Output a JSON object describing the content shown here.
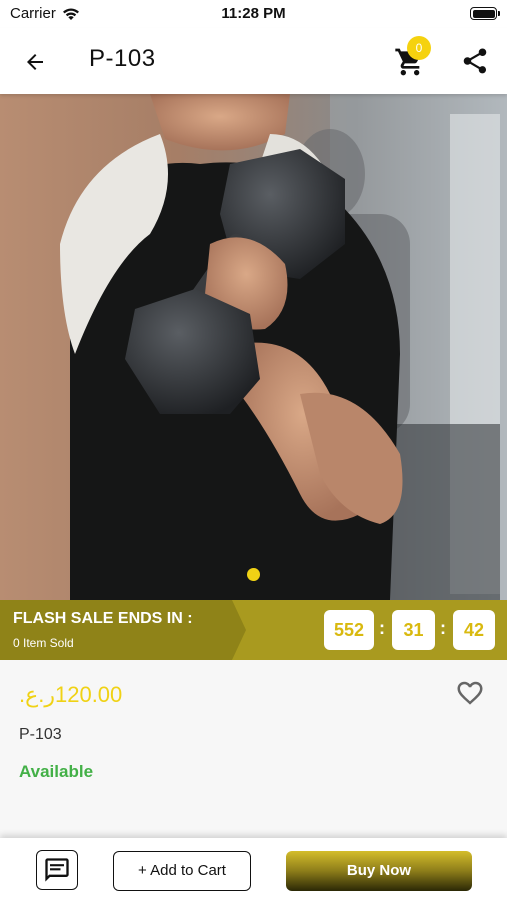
{
  "status_bar": {
    "carrier": "Carrier",
    "time": "11:28 PM"
  },
  "app_bar": {
    "title": "P-103",
    "cart_count": "0",
    "icons": [
      "back-arrow-icon",
      "cart-icon",
      "share-icon"
    ]
  },
  "gallery": {
    "image_subject": "man lifting dumbbell",
    "slide_index": 1,
    "slide_count": 1
  },
  "flash_sale": {
    "title": "FLASH SALE ENDS IN :",
    "sold_text": "0 Item Sold",
    "hours": "552",
    "minutes": "31",
    "seconds": "42",
    "separator": ":"
  },
  "product": {
    "price": "120.00ر.ع.",
    "sku": "P-103",
    "availability": "Available"
  },
  "bottom_bar": {
    "add_to_cart_label": "+ Add to Cart",
    "buy_now_label": "Buy Now"
  },
  "colors": {
    "accent_yellow": "#f0d215",
    "flash_bar": "#a99a1f",
    "available_green": "#43b047"
  }
}
